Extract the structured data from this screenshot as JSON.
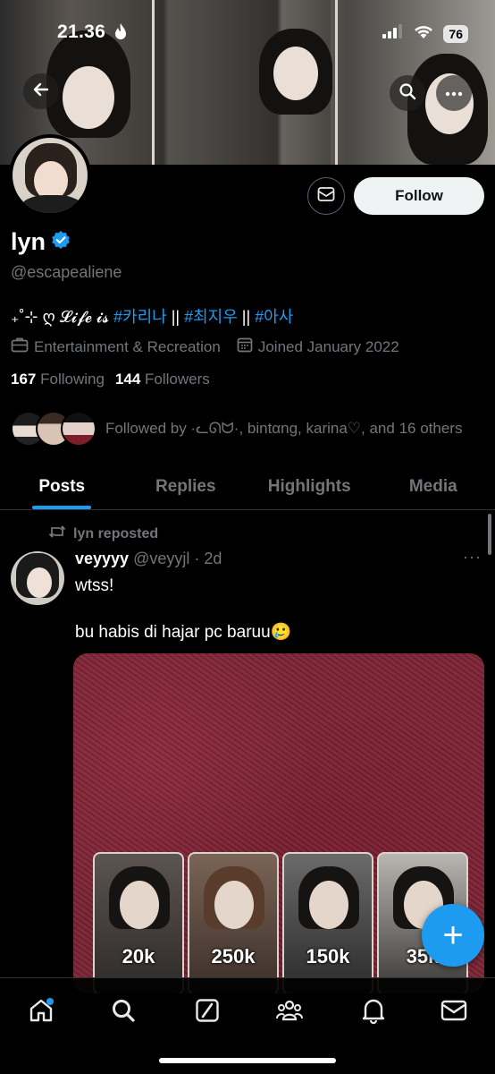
{
  "status_bar": {
    "time": "21.36",
    "battery": "76"
  },
  "profile": {
    "name": "lyn",
    "handle": "@escapealiene",
    "bio": {
      "prefix": "₊˚⊹ ღ 𝓛𝓲𝓯𝓮 𝓲𝓼 ",
      "tag1": "#카리나",
      "sep1": " || ",
      "tag2": "#최지우",
      "sep2": " || ",
      "tag3": "#아사"
    },
    "category": "Entertainment & Recreation",
    "joined": "Joined January 2022",
    "following_count": "167",
    "following_label": "Following",
    "followers_count": "144",
    "followers_label": "Followers",
    "followed_by": "Followed by ·ᓚᘏᗢ·, bintαng, karina♡, and 16 others",
    "follow_label": "Follow"
  },
  "tabs": [
    {
      "label": "Posts",
      "active": true
    },
    {
      "label": "Replies",
      "active": false
    },
    {
      "label": "Highlights",
      "active": false
    },
    {
      "label": "Media",
      "active": false
    }
  ],
  "post": {
    "repost_label": "lyn reposted",
    "author_name": "veyyyy",
    "author_handle": "@veyyjl",
    "age": "· 2d",
    "more": "···",
    "text_line1": "wtss!",
    "text_line2": "bu habis di hajar pc baruu🥲",
    "cards": [
      {
        "price": "20k"
      },
      {
        "price": "250k"
      },
      {
        "price": "150k"
      },
      {
        "price": "35k"
      }
    ]
  },
  "fab_label": "+",
  "icons": {
    "back": "arrow-left-icon",
    "search": "search-icon",
    "more": "more-horizontal-icon",
    "message": "mail-icon",
    "verified": "verified-badge-icon",
    "category": "briefcase-icon",
    "calendar": "calendar-icon",
    "repost": "repost-icon",
    "nav": [
      "home-icon",
      "search-icon",
      "grok-icon",
      "communities-icon",
      "bell-icon",
      "mail-icon"
    ]
  },
  "colors": {
    "accent": "#1d9bf0",
    "muted": "#71767b",
    "background": "#000000"
  }
}
